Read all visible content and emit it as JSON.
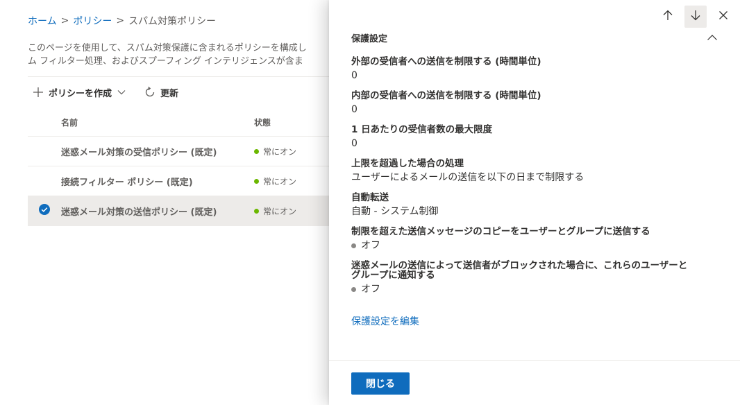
{
  "breadcrumb": {
    "home": "ホーム",
    "policy": "ポリシー",
    "current": "スパム対策ポリシー",
    "separator": ">"
  },
  "description": {
    "line1": "このページを使用して、スパム対策保護に含まれるポリシーを構成し",
    "line2": "ム フィルター処理、およびスプーフィング インテリジェンスが含ま"
  },
  "commandbar": {
    "create_label": "ポリシーを作成",
    "refresh_label": "更新",
    "icons": [
      "plus-icon",
      "chevron-down-icon",
      "refresh-icon"
    ]
  },
  "table": {
    "columns": {
      "name": "名前",
      "status": "状態"
    },
    "rows": [
      {
        "name": "迷惑メール対策の受信ポリシー (既定)",
        "status": "常にオン",
        "selected": false
      },
      {
        "name": "接続フィルター ポリシー (既定)",
        "status": "常にオン",
        "selected": false
      },
      {
        "name": "迷惑メール対策の送信ポリシー (既定)",
        "status": "常にオン",
        "selected": true
      }
    ]
  },
  "panel": {
    "section_title": "保護設定",
    "nav_icons": [
      "arrow-up-icon",
      "arrow-down-icon",
      "close-icon"
    ],
    "fields": [
      {
        "label": "外部の受信者への送信を制限する (時間単位)",
        "value": "0"
      },
      {
        "label": "内部の受信者への送信を制限する (時間単位)",
        "value": "0"
      },
      {
        "label": "1 日あたりの受信者数の最大限度",
        "value": "0"
      },
      {
        "label": "上限を超過した場合の処理",
        "value": "ユーザーによるメールの送信を以下の日まで制限する"
      },
      {
        "label": "自動転送",
        "value": "自動 - システム制御"
      },
      {
        "label": "制限を超えた送信メッセージのコピーをユーザーとグループに送信する",
        "value": "オフ"
      },
      {
        "label_line1": "迷惑メールの送信によって送信者がブロックされた場合に、これらのユーザーと",
        "label_line2": "グループに通知する",
        "value": "オフ"
      }
    ],
    "edit_link": "保護設定を編集",
    "close_button": "閉じる"
  },
  "colors": {
    "accent": "#0f6cbd",
    "status_on": "#6bb700",
    "status_off": "#8a8886"
  }
}
